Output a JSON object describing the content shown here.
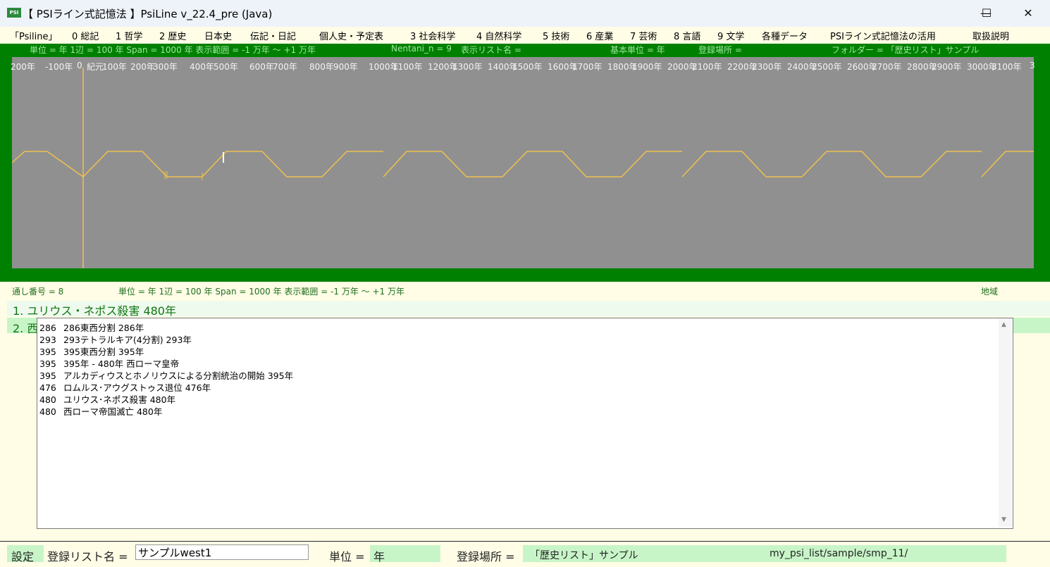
{
  "titlebar": {
    "icon_text": "PSI",
    "title": "【 PSIライン式記憶法 】PsiLine v_22.4_pre (Java)",
    "minimize": "—",
    "maximize": "☐",
    "close": "✕"
  },
  "menu": [
    "「Psiline」",
    "0 総記",
    "1 哲学",
    "2 歴史",
    "日本史",
    "伝記・日記",
    "個人史・予定表",
    "3 社会科学",
    "4 自然科学",
    "5 技術",
    "6 産業",
    "7 芸術",
    "8 言語",
    "9 文学",
    "各種データ",
    "PSIライン式記憶法の活用",
    "取扱説明"
  ],
  "panel_header": {
    "units": "単位 = 年  1辺 = 100 年  Span = 1000 年  表示範囲 = -1 万年 〜 +1 万年",
    "nentani": "Nentani_n = 9",
    "display_list": "表示リスト名 =",
    "base_unit": "基本単位 = 年",
    "reg_place": "登録場所 =",
    "folder": "フォルダー = 「歴史リスト」サンプル"
  },
  "axis_ticks": [
    "200年",
    "-100年",
    "0",
    "紀元",
    "100年",
    "200年",
    "300年",
    "400年",
    "500年",
    "600年",
    "700年",
    "800年",
    "900年",
    "1000年",
    "1100年",
    "1200年",
    "1300年",
    "1400年",
    "1500年",
    "1600年",
    "1700年",
    "1800年",
    "1900年",
    "2000年",
    "2100年",
    "2200年",
    "2300年",
    "2400年",
    "2500年",
    "2600年",
    "2700年",
    "2800年",
    "2900年",
    "3000年",
    "3100年",
    "3"
  ],
  "info": {
    "serial": "通し番号 = 8",
    "units": "単位 = 年  1辺 = 100 年  Span = 1000 年  表示範囲 = -1 万年 〜 +1 万年",
    "region": "地域"
  },
  "entries": [
    "1. ユリウス・ネポス殺害 480年",
    "2. 西"
  ],
  "list": [
    {
      "year": "286",
      "text": "286東西分割 286年"
    },
    {
      "year": "293",
      "text": "293テトラルキア(4分割) 293年"
    },
    {
      "year": "395",
      "text": "395東西分割 395年"
    },
    {
      "year": "395",
      "text": "395年 - 480年 西ローマ皇帝"
    },
    {
      "year": "395",
      "text": "アルカディウスとホノリウスによる分割統治の開始 395年"
    },
    {
      "year": "476",
      "text": "ロムルス･アウグストゥス退位 476年"
    },
    {
      "year": "480",
      "text": "ユリウス･ネポス殺害 480年"
    },
    {
      "year": "480",
      "text": "西ローマ帝国滅亡 480年"
    }
  ],
  "scroll": {
    "up": "▲",
    "down": "▼"
  },
  "bottom": {
    "settings": "設定",
    "reglist_label": "登録リスト名 =",
    "reglist_value": "サンプルwest1",
    "unit_label": "単位 =",
    "unit_value": "年",
    "place_label": "登録場所 =",
    "place_value": "「歴史リスト」サンプル",
    "path": "my_psi_list/sample/smp_11/"
  },
  "colors": {
    "panel_green": "#008000",
    "canvas_gray": "#909090",
    "psi_line": "#f0c050",
    "entry_green": "#c8f5c8"
  }
}
